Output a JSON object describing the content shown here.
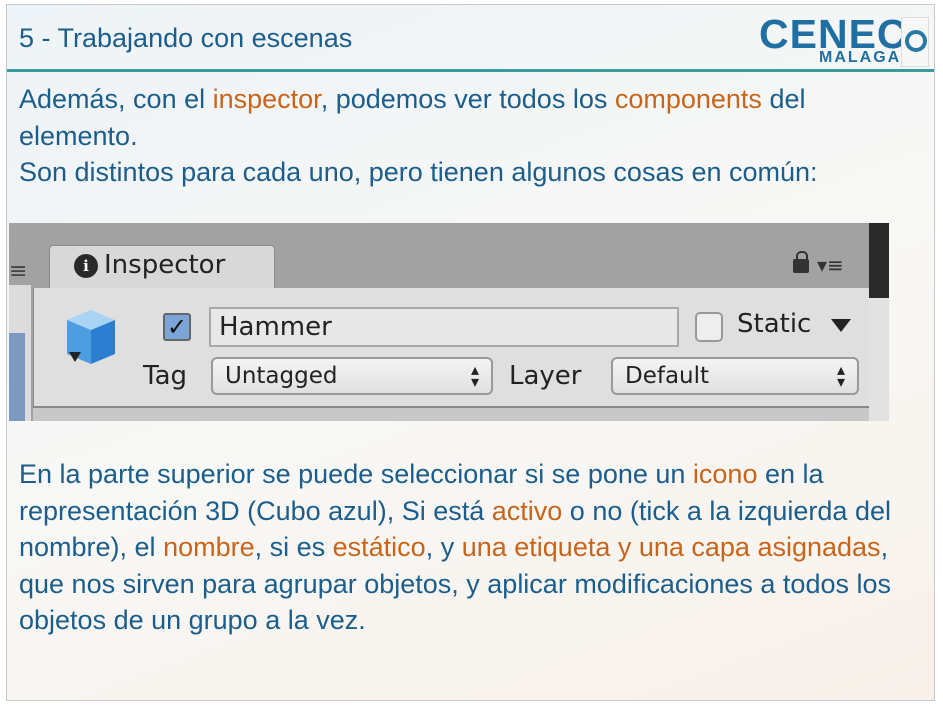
{
  "slide": {
    "title": "5 - Trabajando con escenas",
    "logo": {
      "name": "CENEC",
      "city": "MALAGA"
    }
  },
  "paragraph1": [
    "Además, con el ",
    "inspector",
    ", podemos ver todos los ",
    "components",
    " del elemento.",
    "Son distintos para cada uno, pero tienen algunos cosas en común:"
  ],
  "inspector": {
    "tab_label": "Inspector",
    "info_icon": "i",
    "active": true,
    "object_name": "Hammer",
    "static_label": "Static",
    "static_checked": false,
    "tag_label": "Tag",
    "tag_value": "Untagged",
    "layer_label": "Layer",
    "layer_value": "Default"
  },
  "paragraph2": [
    "En la parte superior se puede seleccionar si se pone un ",
    "icono",
    " en la representación 3D (Cubo azul), Si está ",
    "activo",
    " o no (tick a la izquierda del nombre), el ",
    "nombre",
    ", si es ",
    "estático",
    ", y ",
    "una etiqueta y una capa asignadas",
    ", que nos sirven para agrupar objetos, y aplicar modificaciones a todos los objetos de un grupo a la vez."
  ],
  "colors": {
    "text": "#1b5e8c",
    "highlight": "#c8651b",
    "rule": "#3a9a9c"
  }
}
